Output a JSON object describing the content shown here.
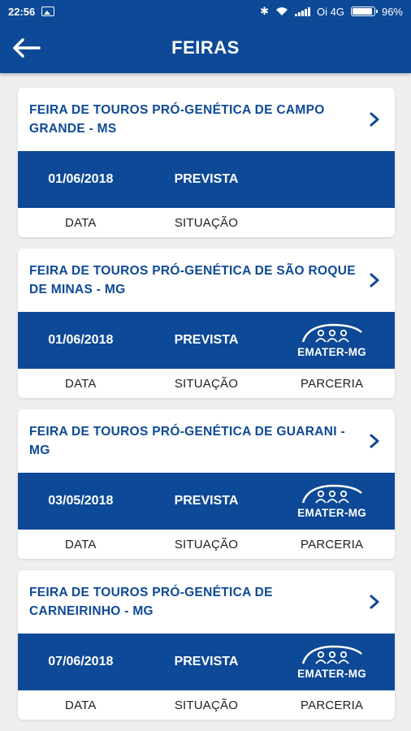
{
  "status_bar": {
    "time": "22:56",
    "carrier": "Oi 4G",
    "battery": "96%"
  },
  "app_bar": {
    "title": "FEIRAS",
    "back_icon": "arrow-left-icon"
  },
  "labels": {
    "date": "DATA",
    "status": "SITUAÇÃO",
    "partner": "PARCERIA"
  },
  "partner_logo_text": "EMATER-MG",
  "fairs": [
    {
      "title": "FEIRA DE TOUROS PRÓ-GENÉTICA DE CAMPO GRANDE - MS",
      "date": "01/06/2018",
      "status": "PREVISTA",
      "has_partner": false
    },
    {
      "title": "FEIRA DE TOUROS PRÓ-GENÉTICA DE SÃO ROQUE DE MINAS - MG",
      "date": "01/06/2018",
      "status": "PREVISTA",
      "has_partner": true
    },
    {
      "title": "FEIRA DE TOUROS PRÓ-GENÉTICA DE GUARANI - MG",
      "date": "03/05/2018",
      "status": "PREVISTA",
      "has_partner": true
    },
    {
      "title": "FEIRA DE TOUROS PRÓ-GENÉTICA DE CARNEIRINHO - MG",
      "date": "07/06/2018",
      "status": "PREVISTA",
      "has_partner": true
    }
  ],
  "colors": {
    "primary": "#0d4996",
    "background": "#efefef"
  }
}
